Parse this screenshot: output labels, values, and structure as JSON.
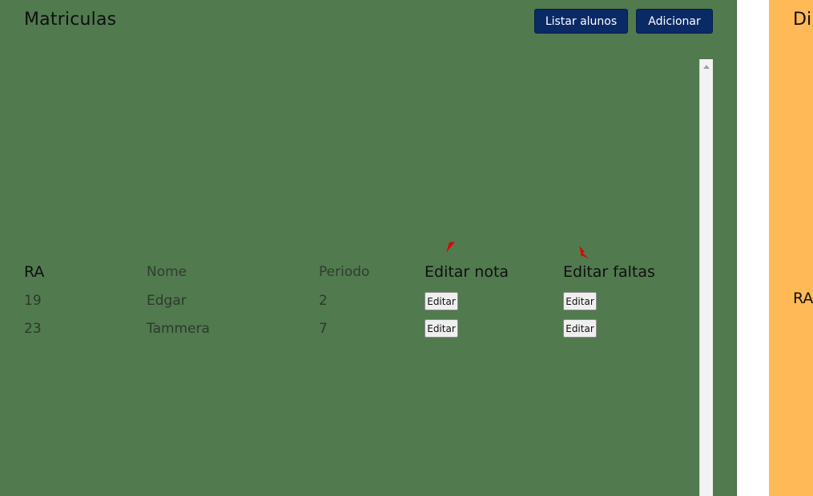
{
  "matriculas": {
    "title": "Matriculas",
    "buttons": {
      "listar": "Listar alunos",
      "adicionar": "Adicionar"
    },
    "table": {
      "headers": {
        "ra": "RA",
        "nome": "Nome",
        "periodo": "Periodo",
        "editar_nota": "Editar nota",
        "editar_faltas": "Editar faltas"
      },
      "rows": [
        {
          "ra": "19",
          "nome": "Edgar",
          "periodo": "2",
          "edit_nota": "Editar",
          "edit_faltas": "Editar"
        },
        {
          "ra": "23",
          "nome": "Tammera",
          "periodo": "7",
          "edit_nota": "Editar",
          "edit_faltas": "Editar"
        }
      ]
    }
  },
  "disciplinas": {
    "title": "Di",
    "ra_header": "RA"
  },
  "colors": {
    "left_panel": "#517a4f",
    "right_panel": "#ffb957",
    "button": "#0a2a66",
    "cursor": "#e00000"
  }
}
